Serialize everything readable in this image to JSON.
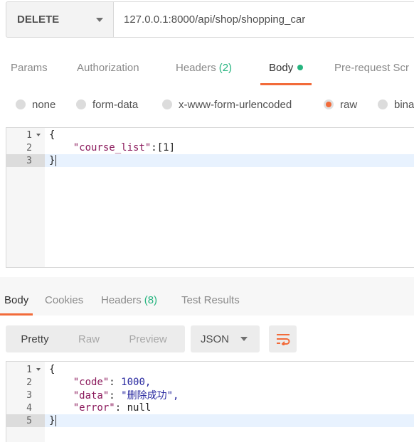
{
  "request": {
    "method": "DELETE",
    "url": "127.0.0.1:8000/api/shop/shopping_car"
  },
  "request_tabs": [
    {
      "label": "Params"
    },
    {
      "label": "Authorization"
    },
    {
      "label": "Headers",
      "count": "(2)"
    },
    {
      "label": "Body"
    },
    {
      "label": "Pre-request Scr"
    }
  ],
  "body_types": [
    {
      "label": "none"
    },
    {
      "label": "form-data"
    },
    {
      "label": "x-www-form-urlencoded"
    },
    {
      "label": "raw",
      "selected": true
    },
    {
      "label": "bina"
    }
  ],
  "request_body": {
    "line_numbers": [
      "1",
      "2",
      "3"
    ],
    "open_brace": "{",
    "key": "\"course_list\"",
    "colon": ":",
    "value": "[1]",
    "close_brace": "}"
  },
  "response_tabs": [
    {
      "label": "Body"
    },
    {
      "label": "Cookies"
    },
    {
      "label": "Headers",
      "count": "(8)"
    },
    {
      "label": "Test Results"
    }
  ],
  "response_view": {
    "modes": [
      "Pretty",
      "Raw",
      "Preview"
    ],
    "active_mode": "Pretty",
    "format": "JSON",
    "wrap_icon": "wrap-lines-icon"
  },
  "response_body": {
    "line_numbers": [
      "1",
      "2",
      "3",
      "4",
      "5"
    ],
    "open_brace": "{",
    "code_key": "\"code\"",
    "code_value": "1000,",
    "data_key": "\"data\"",
    "data_value": "\"删除成功\",",
    "error_key": "\"error\"",
    "error_value": "null",
    "close_brace": "}"
  },
  "colors": {
    "accent": "#f26b3a",
    "success": "#26b47f"
  }
}
